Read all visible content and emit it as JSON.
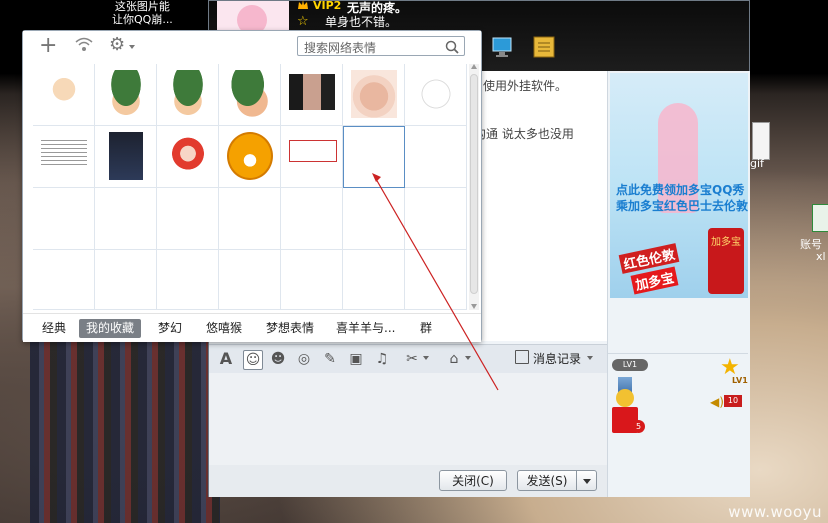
{
  "desktop": {
    "top_text_line1": "这张图片能",
    "top_text_line2": "让你QQ崩...",
    "icon_gif_label": "gif",
    "icon_excel_label_line1": "账号",
    "icon_excel_label_line2": "xl",
    "watermark": "www.wooyu"
  },
  "chat": {
    "vip_badge": "VIP2",
    "nickname": "无声的疼。",
    "signature": "单身也不错。",
    "messages": [
      "使用外挂软件。",
      "沟通 说太多也没用"
    ],
    "toolbar": {
      "history_label": "消息记录"
    },
    "close_label": "关闭(C)",
    "send_label": "发送(S)"
  },
  "ad": {
    "line1": "点此免费领加多宝QQ秀",
    "line2": "乘加多宝红色巴士去伦敦",
    "promo1": "红色伦敦",
    "promo2": "加多宝",
    "can_text": "加多宝"
  },
  "profile": {
    "level": "LV1",
    "level_badge": "LV1",
    "volume_value": "10",
    "gift_count": "5"
  },
  "emoticon_panel": {
    "search_placeholder": "搜索网络表情",
    "tabs": [
      "经典",
      "我的收藏",
      "梦幻",
      "悠嘻猴",
      "梦想表情",
      "喜羊羊与...",
      "群"
    ],
    "active_tab": "我的收藏"
  },
  "colors": {
    "selected_cell_border": "#5a8ec4",
    "active_tab_bg": "#7a7f86",
    "arrow_red": "#cc2222"
  }
}
